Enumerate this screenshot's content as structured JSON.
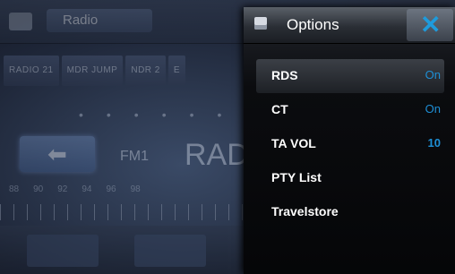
{
  "background": {
    "app_title": "Radio",
    "presets": [
      "RADIO 21",
      "MDR JUMP",
      "NDR 2",
      "E"
    ],
    "band": "FM1",
    "station": "RAD",
    "scale": [
      "88",
      "90",
      "92",
      "94",
      "96",
      "98"
    ]
  },
  "options": {
    "title": "Options",
    "items": [
      {
        "label": "RDS",
        "value": "On"
      },
      {
        "label": "CT",
        "value": "On"
      },
      {
        "label": "TA VOL",
        "value": "10"
      },
      {
        "label": "PTY List",
        "value": ""
      },
      {
        "label": "Travelstore",
        "value": ""
      }
    ]
  },
  "colors": {
    "accent": "#1e8fd6",
    "panel_bg": "#0b0c0f"
  }
}
